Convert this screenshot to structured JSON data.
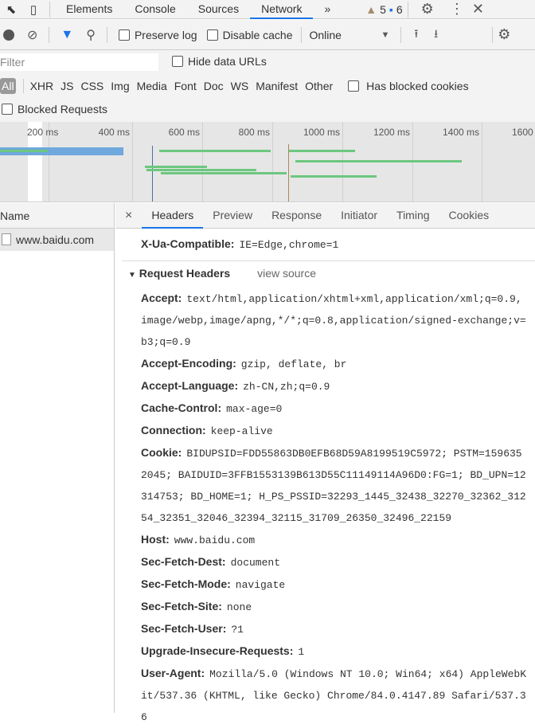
{
  "toolbar": {
    "tabs": [
      "Elements",
      "Console",
      "Sources",
      "Network"
    ],
    "more": "»",
    "warnings": "5",
    "messages": "6"
  },
  "network_bar": {
    "preserve_log": "Preserve log",
    "disable_cache": "Disable cache",
    "throttle": "Online"
  },
  "filter": {
    "placeholder": "Filter",
    "hide_data_urls": "Hide data URLs",
    "types": [
      "All",
      "XHR",
      "JS",
      "CSS",
      "Img",
      "Media",
      "Font",
      "Doc",
      "WS",
      "Manifest",
      "Other"
    ],
    "has_blocked_cookies": "Has blocked cookies",
    "blocked_requests": "Blocked Requests"
  },
  "timeline": {
    "ticks": [
      "200 ms",
      "400 ms",
      "600 ms",
      "800 ms",
      "1000 ms",
      "1200 ms",
      "1400 ms",
      "1600"
    ]
  },
  "list": {
    "header": "Name",
    "items": [
      "www.baidu.com"
    ]
  },
  "details": {
    "close": "×",
    "tabs": [
      "Headers",
      "Preview",
      "Response",
      "Initiator",
      "Timing",
      "Cookies"
    ],
    "prev_header": {
      "name": "X-Ua-Compatible:",
      "value": "IE=Edge,chrome=1"
    },
    "section_title": "Request Headers",
    "view_source": "view source",
    "headers": [
      {
        "name": "Accept:",
        "value": "text/html,application/xhtml+xml,application/xml;q=0.9,image/webp,image/apng,*/*;q=0.8,application/signed-exchange;v=b3;q=0.9"
      },
      {
        "name": "Accept-Encoding:",
        "value": "gzip, deflate, br"
      },
      {
        "name": "Accept-Language:",
        "value": "zh-CN,zh;q=0.9"
      },
      {
        "name": "Cache-Control:",
        "value": "max-age=0"
      },
      {
        "name": "Connection:",
        "value": "keep-alive"
      },
      {
        "name": "Cookie:",
        "value": "BIDUPSID=FDD55863DB0EFB68D59A8199519C5972; PSTM=1596352045; BAIDUID=3FFB1553139B613D55C11149114A96D0:FG=1; BD_UPN=12314753; BD_HOME=1; H_PS_PSSID=32293_1445_32438_32270_32362_31254_32351_32046_32394_32115_31709_26350_32496_22159"
      },
      {
        "name": "Host:",
        "value": "www.baidu.com"
      },
      {
        "name": "Sec-Fetch-Dest:",
        "value": "document"
      },
      {
        "name": "Sec-Fetch-Mode:",
        "value": "navigate"
      },
      {
        "name": "Sec-Fetch-Site:",
        "value": "none"
      },
      {
        "name": "Sec-Fetch-User:",
        "value": "?1"
      },
      {
        "name": "Upgrade-Insecure-Requests:",
        "value": "1"
      },
      {
        "name": "User-Agent:",
        "value": "Mozilla/5.0 (Windows NT 10.0; Win64; x64) AppleWebKit/537.36 (KHTML, like Gecko) Chrome/84.0.4147.89 Safari/537.36"
      }
    ]
  }
}
